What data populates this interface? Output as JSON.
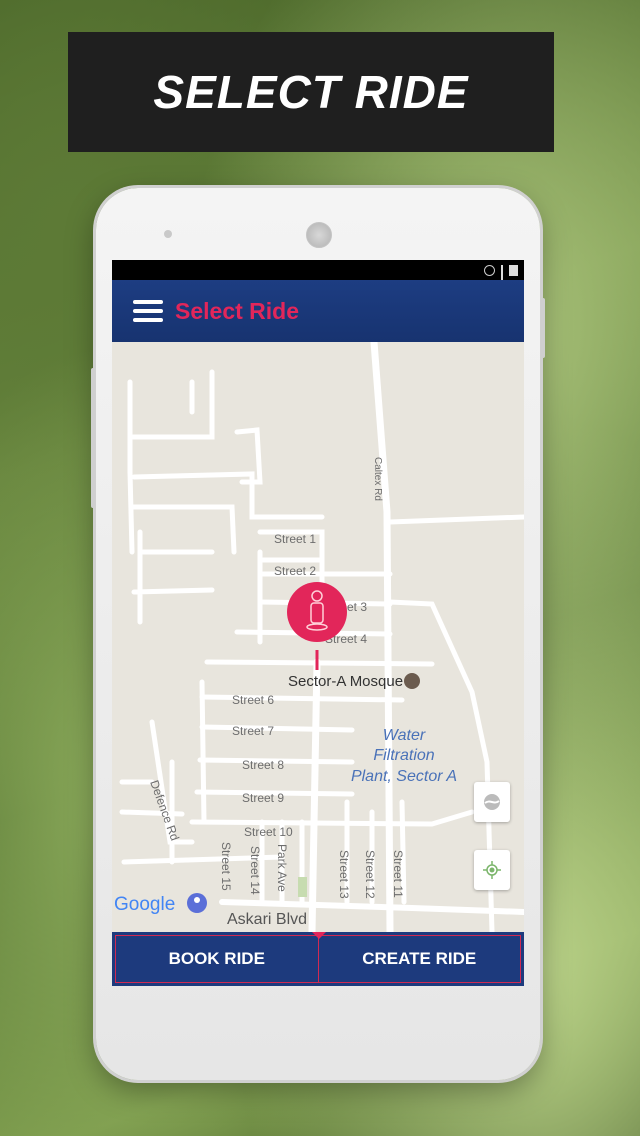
{
  "banner": {
    "title": "SELECT RIDE"
  },
  "appbar": {
    "title": "Select Ride",
    "title_color": "#e2265a",
    "bar_color": "#1d3d82"
  },
  "statusbar": {
    "icons": [
      "alarm-icon",
      "signal-icon",
      "battery-icon"
    ]
  },
  "map": {
    "streets": [
      "Street 1",
      "Street 2",
      "Street 3",
      "Street 4",
      "Street 6",
      "Street 7",
      "Street 8",
      "Street 9",
      "Street 10",
      "Street 15",
      "Street 14",
      "Park Ave",
      "Street 13",
      "Street 12",
      "Street 11"
    ],
    "road_labels": {
      "caltex": "Caltex Rd",
      "defence": "Defence Rd",
      "askari": "Askari Blvd"
    },
    "poi": {
      "mosque": "Sector-A Mosque",
      "water_l1": "Water",
      "water_l2": "Filtration",
      "water_l3": "Plant, Sector A"
    },
    "google_logo": "Google",
    "buttons": [
      "earth-icon",
      "location-icon"
    ]
  },
  "bottom": {
    "book_label": "BOOK RIDE",
    "create_label": "CREATE RIDE",
    "accent": "#d02a52"
  }
}
